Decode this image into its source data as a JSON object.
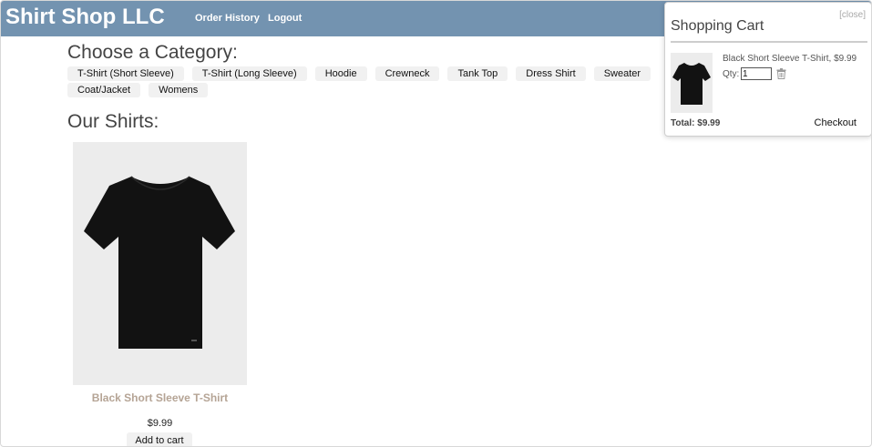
{
  "header": {
    "brand": "Shirt Shop LLC",
    "nav": {
      "order_history": "Order History",
      "logout": "Logout"
    },
    "background_color": "#7393b0"
  },
  "categories": {
    "heading": "Choose a Category:",
    "items": [
      "T-Shirt (Short Sleeve)",
      "T-Shirt (Long Sleeve)",
      "Hoodie",
      "Crewneck",
      "Tank Top",
      "Dress Shirt",
      "Sweater",
      "Coat/Jacket",
      "Womens"
    ]
  },
  "products": {
    "heading": "Our Shirts:",
    "items": [
      {
        "name": "Black Short Sleeve T-Shirt",
        "price": "$9.99",
        "add_label": "Add to cart",
        "image_icon": "black-tshirt-image",
        "name_color": "#b5a495"
      }
    ]
  },
  "cart": {
    "close_label": "[close]",
    "title": "Shopping Cart",
    "items": [
      {
        "name": "Black Short Sleeve T-Shirt, $9.99",
        "qty_label": "Qty:",
        "qty_value": "1",
        "remove_icon": "trash-icon"
      }
    ],
    "total": "Total: $9.99",
    "checkout_label": "Checkout"
  }
}
